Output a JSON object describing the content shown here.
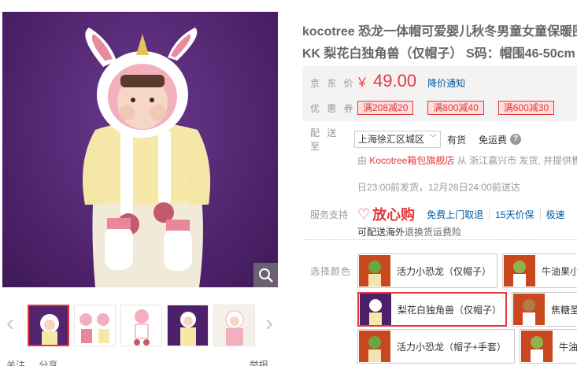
{
  "product": {
    "title_line1": "kocotree 恐龙一体帽可爱婴儿秋冬男童女童保暖围",
    "title_line2": "KK 梨花白独角兽（仅帽子） S码：帽围46-50cm"
  },
  "price": {
    "label": "京 东 价",
    "currency": "￥",
    "value": "49.00",
    "notify": "降价通知"
  },
  "coupons": {
    "label": "优 惠 券",
    "items": [
      "满208减20",
      "满800减40",
      "满600减30"
    ]
  },
  "shipping": {
    "label": "配 送 至",
    "region": "上海徐汇区城区",
    "stock": "有货",
    "freight": "免运费",
    "seller_prefix": "由",
    "seller_shop": "Kocotree箱包旗舰店",
    "seller_suffix": "从 浙江嘉兴市 发货, 并提供售",
    "delivery": "日23:00前发货，12月28日24:00前送达"
  },
  "service": {
    "label": "服务支持",
    "brand": "放心购",
    "items": [
      "免费上门取退",
      "15天价保",
      "极速"
    ],
    "overseas_link": "可配送海外",
    "overseas_rest": "退换货运费险"
  },
  "colors": {
    "label": "选择颜色",
    "options": [
      {
        "name": "活力小恐龙（仅帽子）",
        "selected": false
      },
      {
        "name": "牛油果小",
        "selected": false
      },
      {
        "name": "梨花白独角兽（仅帽子）",
        "selected": true
      },
      {
        "name": "焦糖圣",
        "selected": false
      },
      {
        "name": "活力小恐龙（帽子+手套）",
        "selected": false
      },
      {
        "name": "牛油",
        "selected": false
      }
    ]
  },
  "gallery": {
    "thumb_count": 5,
    "active_index": 0
  },
  "share": {
    "follow": "关注",
    "share": "分享",
    "report": "举报"
  },
  "palette": {
    "accent": "#e4393c",
    "link": "#005aa0",
    "photo_bg": "#4d2169"
  }
}
